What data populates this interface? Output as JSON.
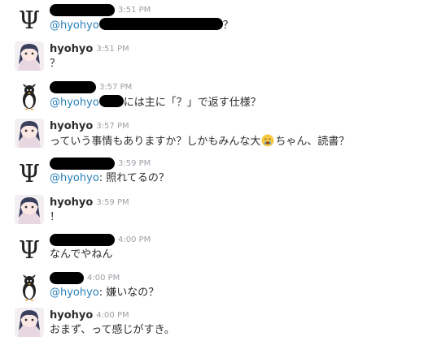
{
  "timestamps": [
    "3:51 PM",
    "3:51 PM",
    "3:57 PM",
    "3:57 PM",
    "3:59 PM",
    "3:59 PM",
    "4:00 PM",
    "4:00 PM",
    "4:00 PM"
  ],
  "users": {
    "hyohyo": "hyohyo"
  },
  "messages": {
    "m1": {
      "mention": "@hyohyo",
      "suffix": "？"
    },
    "m2": {
      "text": "？"
    },
    "m3": {
      "mention": "@hyohyo",
      "suffix": "には主に「？」で返す仕様？"
    },
    "m4": {
      "prefix": "っていう事情もありますか？しかもみんな大",
      "suffix": "ちゃん、読書？"
    },
    "m5": {
      "mention": "@hyohyo",
      "suffix": ": 照れてるの？"
    },
    "m6": {
      "text": "！"
    },
    "m7": {
      "text": "なんでやねん"
    },
    "m8": {
      "mention": "@hyohyo",
      "suffix": ": 嫌いなの？"
    },
    "m9": {
      "text": "おまず、って感じがすき。"
    }
  },
  "icons": {
    "psi_avatar": "psi-logo-icon",
    "anime_avatar": "anime-girl-avatar-icon",
    "penguin_avatar": "penguin-avatar-icon",
    "emoji": "crying-face-emoji-icon"
  },
  "colors": {
    "mention": "#2a80b9",
    "timestamp": "#9e9ea6",
    "text": "#2c2d30"
  }
}
